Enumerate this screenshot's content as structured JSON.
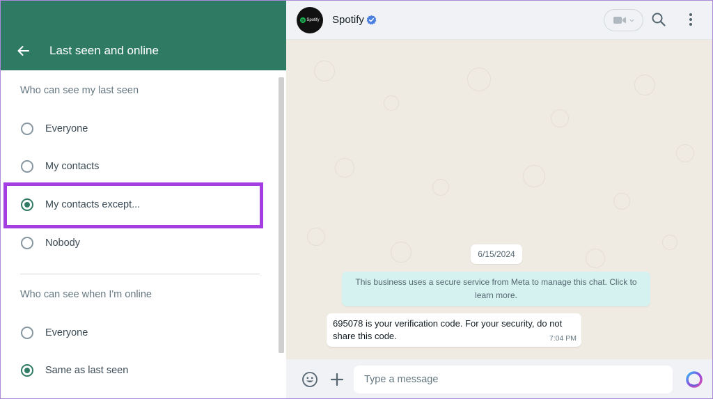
{
  "left_panel": {
    "title": "Last seen and online",
    "last_seen": {
      "section_title": "Who can see my last seen",
      "options": [
        {
          "label": "Everyone",
          "selected": false
        },
        {
          "label": "My contacts",
          "selected": false
        },
        {
          "label": "My contacts except...",
          "selected": true
        },
        {
          "label": "Nobody",
          "selected": false
        }
      ]
    },
    "online": {
      "section_title": "Who can see when I'm online",
      "options": [
        {
          "label": "Everyone",
          "selected": false
        },
        {
          "label": "Same as last seen",
          "selected": true
        }
      ]
    }
  },
  "chat": {
    "contact_name": "Spotify",
    "avatar_text": "Spotify",
    "verified": true,
    "date_chip": "6/15/2024",
    "system_message": "This business uses a secure service from Meta to manage this chat. Click to learn more.",
    "messages": [
      {
        "text": "695078 is your verification code. For your security, do not share this code.",
        "time": "7:04 PM"
      }
    ],
    "composer_placeholder": "Type a message"
  },
  "colors": {
    "header_green": "#2f7a63",
    "radio_checked": "#2f7a63",
    "highlight_border": "#a43ee0",
    "chat_background": "#efeae2",
    "system_bubble": "#d5f2f0",
    "verified_badge": "#4a7fe0"
  },
  "icons": {
    "back": "arrow-left-icon",
    "verified": "verified-badge-icon",
    "video": "video-camera-icon",
    "search": "search-icon",
    "menu": "more-vertical-icon",
    "emoji": "emoji-icon",
    "attach": "plus-icon",
    "ai": "meta-ai-icon"
  }
}
